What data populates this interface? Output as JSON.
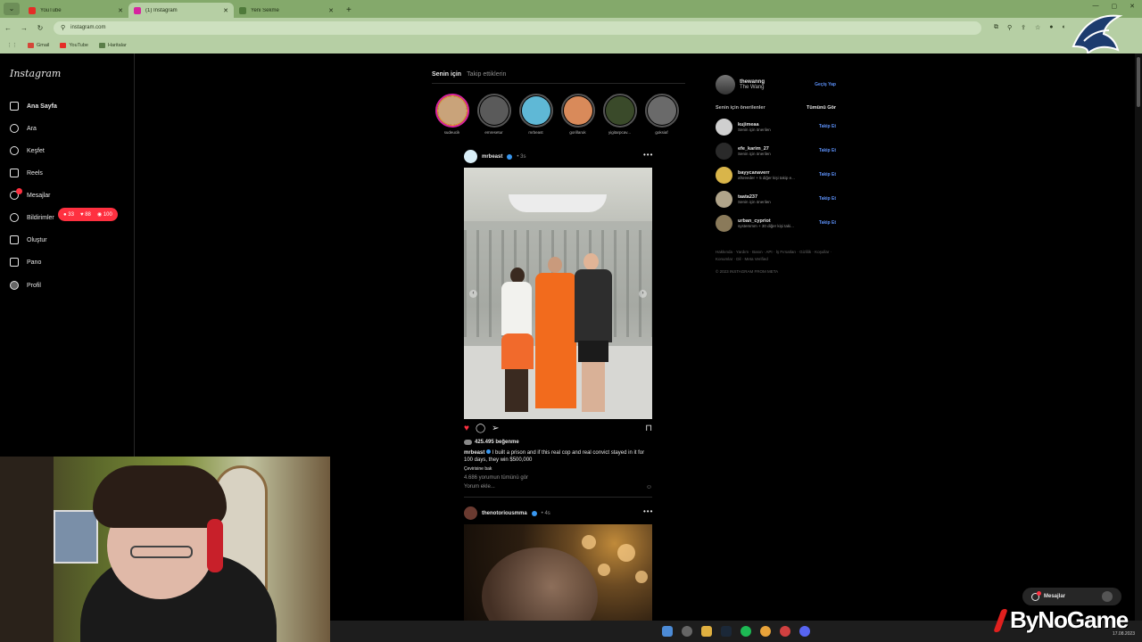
{
  "browser": {
    "tabs": [
      {
        "title": "YouTube",
        "active": false,
        "color": "#e52d27"
      },
      {
        "title": "(1) Instagram",
        "active": true,
        "color": "#d6249f"
      },
      {
        "title": "Yeni Sekme",
        "active": false,
        "color": "#4f7a3a"
      }
    ],
    "url": "instagram.com",
    "bookmarks": [
      {
        "label": "Gmail",
        "color": "#d44638"
      },
      {
        "label": "YouTube",
        "color": "#e52d27"
      },
      {
        "label": "Haritalar",
        "color": "#5a7d48"
      }
    ]
  },
  "instagram": {
    "logo": "Instagram",
    "nav": [
      {
        "label": "Ana Sayfa",
        "icon": "home-icon"
      },
      {
        "label": "Ara",
        "icon": "search-icon"
      },
      {
        "label": "Keşfet",
        "icon": "compass-icon"
      },
      {
        "label": "Reels",
        "icon": "reels-icon"
      },
      {
        "label": "Mesajlar",
        "icon": "messenger-icon"
      },
      {
        "label": "Bildirimler",
        "icon": "heart-icon"
      },
      {
        "label": "Oluştur",
        "icon": "plus-icon"
      },
      {
        "label": "Pano",
        "icon": "dashboard-icon"
      },
      {
        "label": "Profil",
        "icon": "profile-icon"
      }
    ],
    "notification_badge": {
      "comments": "33",
      "likes": "88",
      "follows": "100"
    },
    "feed_tabs": {
      "for_you": "Senin için",
      "following": "Takip ettiklerin"
    },
    "stories": [
      {
        "name": "sudeucik",
        "color": "#c9a37a",
        "new": true
      },
      {
        "name": "emresetur",
        "color": "#5a5a5a",
        "new": false
      },
      {
        "name": "mrbeast",
        "color": "#5fb8d6",
        "new": false
      },
      {
        "name": "gorillaruk",
        "color": "#d98a5a",
        "new": false
      },
      {
        "name": "yigitarpcav...",
        "color": "#3a4a2a",
        "new": false
      },
      {
        "name": "goksiaf",
        "color": "#6a6a6a",
        "new": false
      }
    ],
    "post1": {
      "username": "mrbeast",
      "time": "• 3s",
      "likes": "425.495 beğenme",
      "caption_text": "I built a prison and if this real cop and real convict stayed in it for 100 days, they win $500,000",
      "translate": "Çevirisine bak",
      "comments": "4.686 yorumun tümünü gör",
      "add_comment": "Yorum ekle..."
    },
    "post2": {
      "username": "thenotoriousmma",
      "time": "• 4s"
    },
    "profile": {
      "username": "thewanng",
      "name": "The Wang",
      "switch": "Geçiş Yap"
    },
    "suggestions_title": "Senin için önerilenler",
    "see_all": "Tümünü Gör",
    "suggestions": [
      {
        "username": "kujimeaa",
        "sub": "Senin için önerilen",
        "follow": "Takip Et",
        "color": "#cfcfcf"
      },
      {
        "username": "efe_karim_27",
        "sub": "Senin için önerilen",
        "follow": "Takip Et",
        "color": "#2a2a2a"
      },
      {
        "username": "bayycanaverr",
        "sub": "afsreeder + 5 diğer kişi takip e...",
        "follow": "Takip Et",
        "color": "#d9b54a"
      },
      {
        "username": "taata237",
        "sub": "Senin için önerilen",
        "follow": "Takip Et",
        "color": "#b0a48a"
      },
      {
        "username": "urban_cypriot",
        "sub": "systemmm + 30 diğer kişi taki...",
        "follow": "Takip Et",
        "color": "#8a7a5a"
      }
    ],
    "footer_links": "Hakkında · Yardım · Basın · API · İş Fırsatları · Gizlilik · Koşullar · Konumlar · Dil · Meta Verified",
    "copyright": "© 2023 INSTAGRAM FROM META",
    "messages_pill": "Mesajlar"
  },
  "taskbar": {
    "time": "17.08.2023"
  },
  "watermark": "ByNoGame"
}
